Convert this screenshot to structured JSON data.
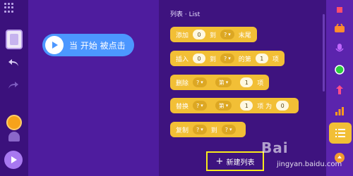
{
  "canvas": {
    "event_block": {
      "label": "当 开始 被点击"
    }
  },
  "palette": {
    "category_title": "列表 · List",
    "blocks": [
      {
        "name": "add-block",
        "parts": [
          {
            "t": "text",
            "v": "添加"
          },
          {
            "t": "slot",
            "v": "0"
          },
          {
            "t": "text",
            "v": "到"
          },
          {
            "t": "drop",
            "v": "?"
          },
          {
            "t": "text",
            "v": "末尾"
          }
        ]
      },
      {
        "name": "insert-block",
        "parts": [
          {
            "t": "text",
            "v": "插入"
          },
          {
            "t": "slot",
            "v": "0"
          },
          {
            "t": "text",
            "v": "到"
          },
          {
            "t": "drop",
            "v": "?"
          },
          {
            "t": "text",
            "v": "的第"
          },
          {
            "t": "slot",
            "v": "1"
          },
          {
            "t": "text",
            "v": "项"
          }
        ]
      },
      {
        "name": "delete-block",
        "parts": [
          {
            "t": "text",
            "v": "删除"
          },
          {
            "t": "drop",
            "v": "?"
          },
          {
            "t": "drop",
            "v": "第"
          },
          {
            "t": "slot",
            "v": "1"
          },
          {
            "t": "text",
            "v": "项"
          }
        ]
      },
      {
        "name": "replace-block",
        "parts": [
          {
            "t": "text",
            "v": "替换"
          },
          {
            "t": "drop",
            "v": "?"
          },
          {
            "t": "drop",
            "v": "第"
          },
          {
            "t": "slot",
            "v": "1"
          },
          {
            "t": "text",
            "v": "项 为"
          },
          {
            "t": "slot",
            "v": "0"
          }
        ]
      },
      {
        "name": "copy-block",
        "parts": [
          {
            "t": "text",
            "v": "复制"
          },
          {
            "t": "drop",
            "v": "?"
          },
          {
            "t": "text",
            "v": "到"
          },
          {
            "t": "drop",
            "v": "?"
          }
        ]
      }
    ],
    "new_list_label": "新建列表"
  },
  "watermark": {
    "brand": "Bai",
    "text": "jingyan.baidu.com"
  },
  "colors": {
    "list_block": "#f2bf36",
    "event_block": "#4c97ff",
    "highlight": "#f8ea1c"
  },
  "icons": {
    "left": [
      "grid-icon",
      "sprite-icon",
      "undo-icon",
      "redo-icon",
      "character-icon",
      "ghost-icon",
      "play-icon"
    ],
    "rail": [
      "motion-icon",
      "looks-icon",
      "sound-icon",
      "events-icon",
      "data-icon",
      "list-icon",
      "extension-icon"
    ]
  }
}
